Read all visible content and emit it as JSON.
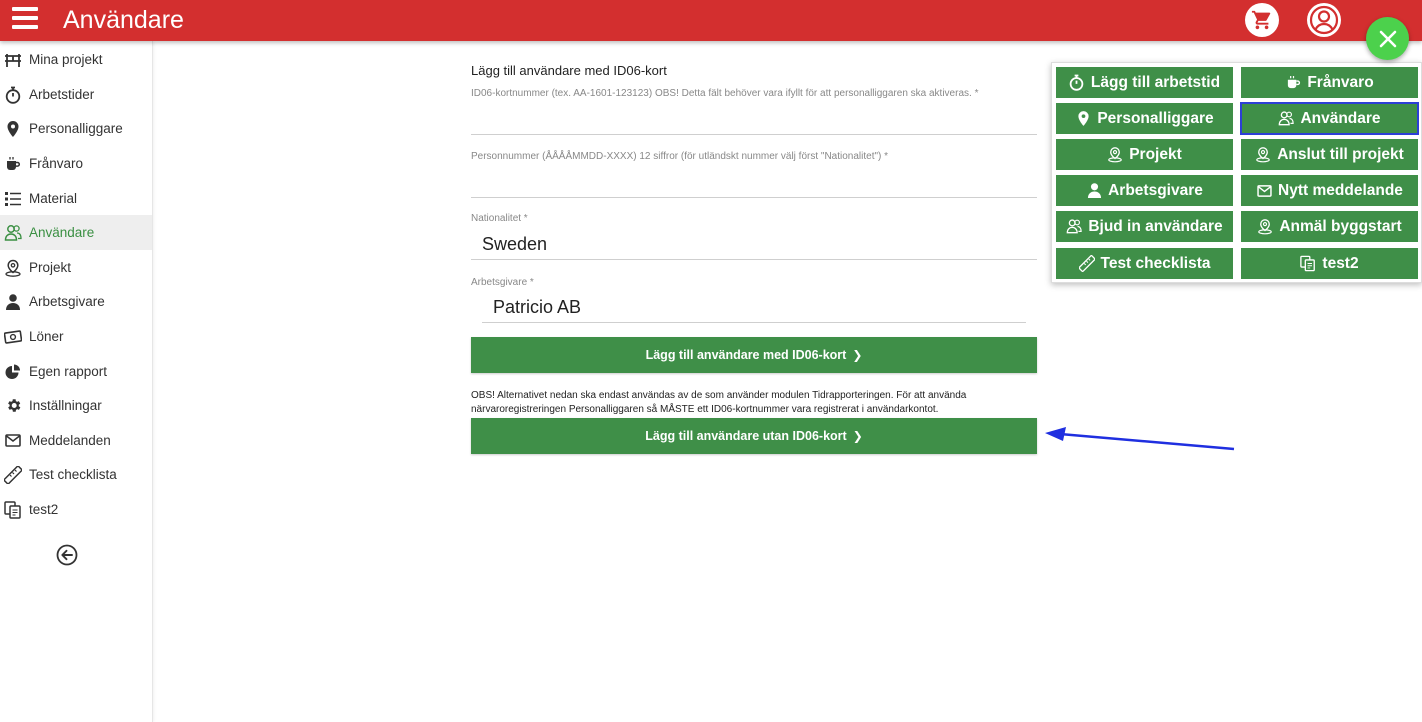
{
  "header": {
    "title": "Användare",
    "menu_icon": "hamburger-icon",
    "cart_icon": "cart-icon",
    "profile_icon": "user-icon",
    "close_icon": "close-icon"
  },
  "sidebar": {
    "items": [
      {
        "label": "Mina projekt",
        "icon": "projects-icon"
      },
      {
        "label": "Arbetstider",
        "icon": "stopwatch-icon"
      },
      {
        "label": "Personalliggare",
        "icon": "map-pin-icon"
      },
      {
        "label": "Frånvaro",
        "icon": "coffee-icon"
      },
      {
        "label": "Material",
        "icon": "list-icon"
      },
      {
        "label": "Användare",
        "icon": "users-icon",
        "active": true
      },
      {
        "label": "Projekt",
        "icon": "location-icon"
      },
      {
        "label": "Arbetsgivare",
        "icon": "person-icon"
      },
      {
        "label": "Löner",
        "icon": "money-icon"
      },
      {
        "label": "Egen rapport",
        "icon": "pie-chart-icon"
      },
      {
        "label": "Inställningar",
        "icon": "gear-icon"
      },
      {
        "label": "Meddelanden",
        "icon": "envelope-icon"
      },
      {
        "label": "Test checklista",
        "icon": "ruler-icon"
      },
      {
        "label": "test2",
        "icon": "copy-icon"
      }
    ],
    "back_icon": "arrow-left-circle-icon"
  },
  "form": {
    "title": "Lägg till användare med ID06-kort",
    "id06_label": "ID06-kortnummer (tex. AA-1601-123123) OBS! Detta fält behöver vara ifyllt för att personalliggaren ska aktiveras. *",
    "id06_value": "",
    "personnummer_label": "Personnummer (ÅÅÅÅMMDD-XXXX) 12 siffror (för utländskt nummer välj först \"Nationalitet\") *",
    "personnummer_value": "",
    "nationality_label": "Nationalitet *",
    "nationality_value": "Sweden",
    "employer_label": "Arbetsgivare *",
    "employer_value": "Patricio AB",
    "add_with_id06_button": "Lägg till användare med ID06-kort",
    "note": "OBS! Alternativet nedan ska endast användas av de som använder modulen Tidrapporteringen. För att använda närvaroregistreringen Personalliggaren så MÅSTE ett ID06-kortnummer vara registrerat i användarkontot.",
    "add_without_id06_button": "Lägg till användare utan ID06-kort"
  },
  "quick_menu": {
    "items": [
      {
        "label": "Lägg till arbetstid",
        "icon": "stopwatch-icon"
      },
      {
        "label": "Frånvaro",
        "icon": "coffee-icon"
      },
      {
        "label": "Personalliggare",
        "icon": "map-pin-icon"
      },
      {
        "label": "Användare",
        "icon": "users-icon",
        "selected": true
      },
      {
        "label": "Projekt",
        "icon": "location-icon"
      },
      {
        "label": "Anslut till projekt",
        "icon": "location-icon"
      },
      {
        "label": "Arbetsgivare",
        "icon": "person-icon"
      },
      {
        "label": "Nytt meddelande",
        "icon": "envelope-icon"
      },
      {
        "label": "Bjud in användare",
        "icon": "users-icon"
      },
      {
        "label": "Anmäl byggstart",
        "icon": "location-icon"
      },
      {
        "label": "Test checklista",
        "icon": "ruler-icon"
      },
      {
        "label": "test2",
        "icon": "copy-icon"
      }
    ]
  },
  "colors": {
    "header_red": "#d32f2f",
    "button_green": "#3f8f48",
    "fab_green": "#4cd14c",
    "highlight_blue": "#2d3fd6",
    "active_text_green": "#3a8f42"
  }
}
